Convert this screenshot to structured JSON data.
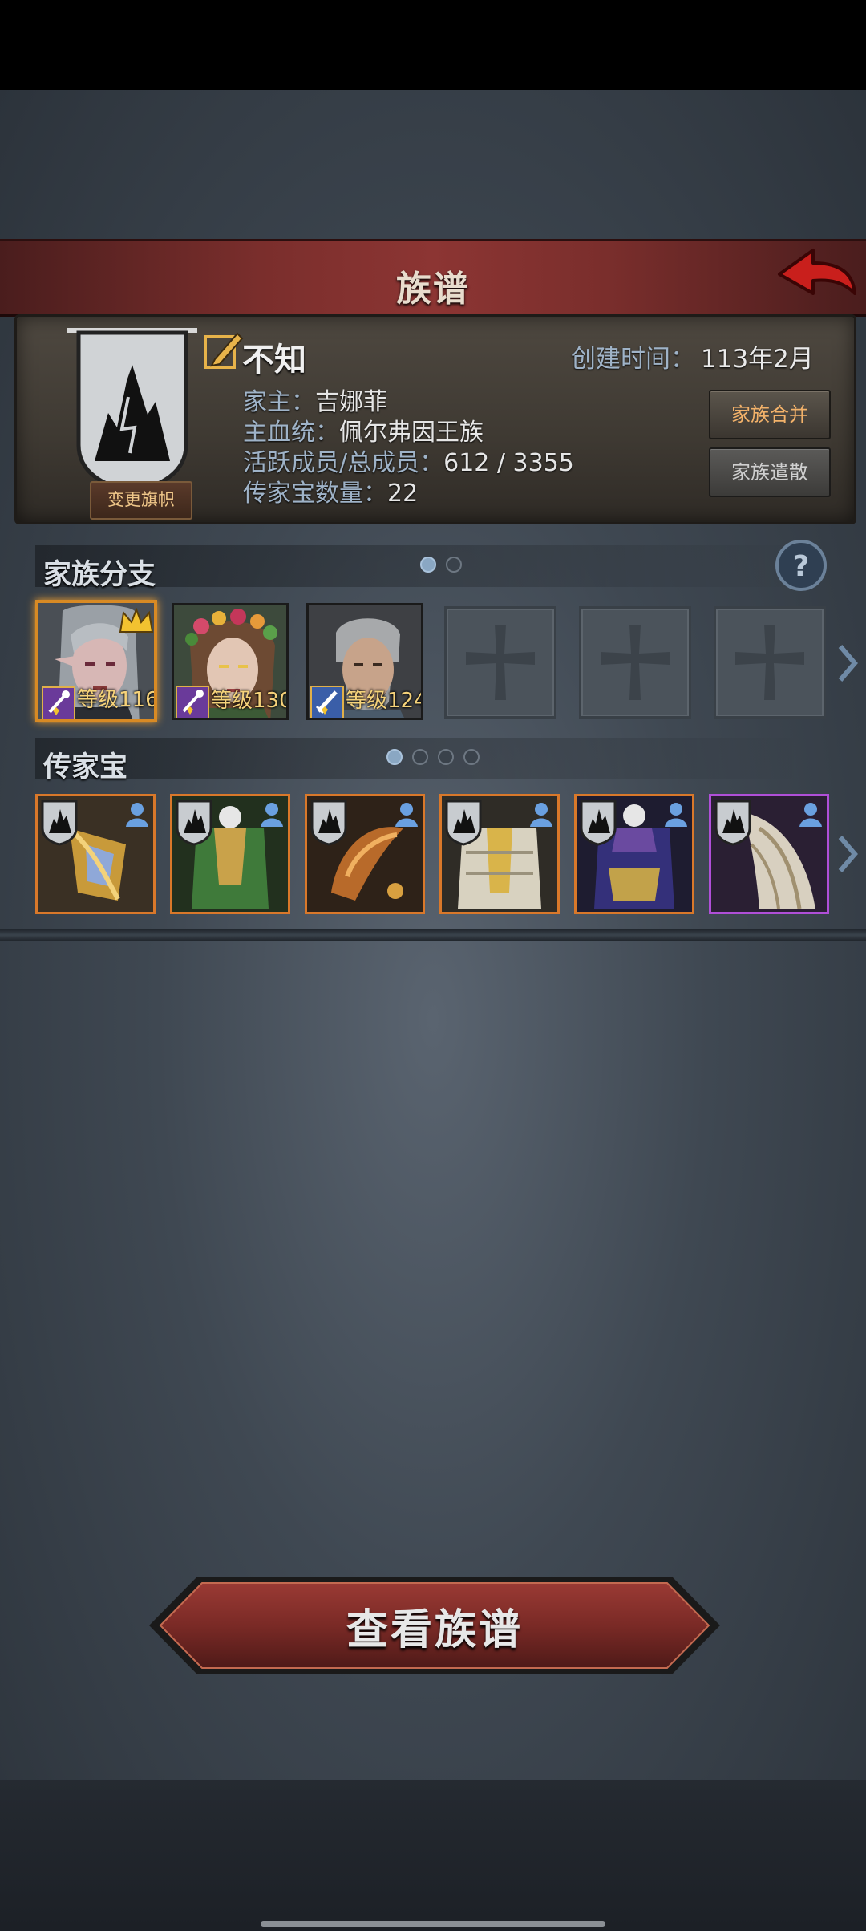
{
  "header": {
    "title": "族谱"
  },
  "family": {
    "name": "不知",
    "change_banner_label": "变更旗帜",
    "created_label": "创建时间：",
    "created_value": "113年2月",
    "head_label": "家主：",
    "head_value": "吉娜菲",
    "bloodline_label": "主血统：",
    "bloodline_value": "佩尔弗因王族",
    "members_label": "活跃成员/总成员：",
    "members_value": "612 / 3355",
    "heirloom_count_label": "传家宝数量：",
    "heirloom_count_value": "22",
    "merge_button": "家族合并",
    "disband_button": "家族遣散"
  },
  "branches": {
    "title": "家族分支",
    "page_dots": 2,
    "active_page": 1,
    "members": [
      {
        "level_text": "等级116",
        "leader": true,
        "icon": "elf-woman-portrait"
      },
      {
        "level_text": "等级130",
        "leader": false,
        "icon": "flower-crown-woman-portrait"
      },
      {
        "level_text": "等级124",
        "leader": false,
        "icon": "gray-haired-man-portrait"
      }
    ],
    "empty_slots": 3
  },
  "heirlooms": {
    "title": "传家宝",
    "page_dots": 4,
    "active_page": 1,
    "items": [
      {
        "icon": "golden-shield-heirloom",
        "rarity": "orange"
      },
      {
        "icon": "green-armor-heirloom",
        "rarity": "orange"
      },
      {
        "icon": "bronze-blade-heirloom",
        "rarity": "orange"
      },
      {
        "icon": "white-gold-armor-heirloom",
        "rarity": "orange"
      },
      {
        "icon": "purple-robe-heirloom",
        "rarity": "orange"
      },
      {
        "icon": "white-cloak-heirloom",
        "rarity": "purple"
      }
    ]
  },
  "footer": {
    "view_button": "查看族谱"
  },
  "colors": {
    "accent_red": "#7a2e2c",
    "gold": "#f3b26a",
    "rarity_orange": "#d9782a",
    "rarity_purple": "#b04fd8"
  }
}
